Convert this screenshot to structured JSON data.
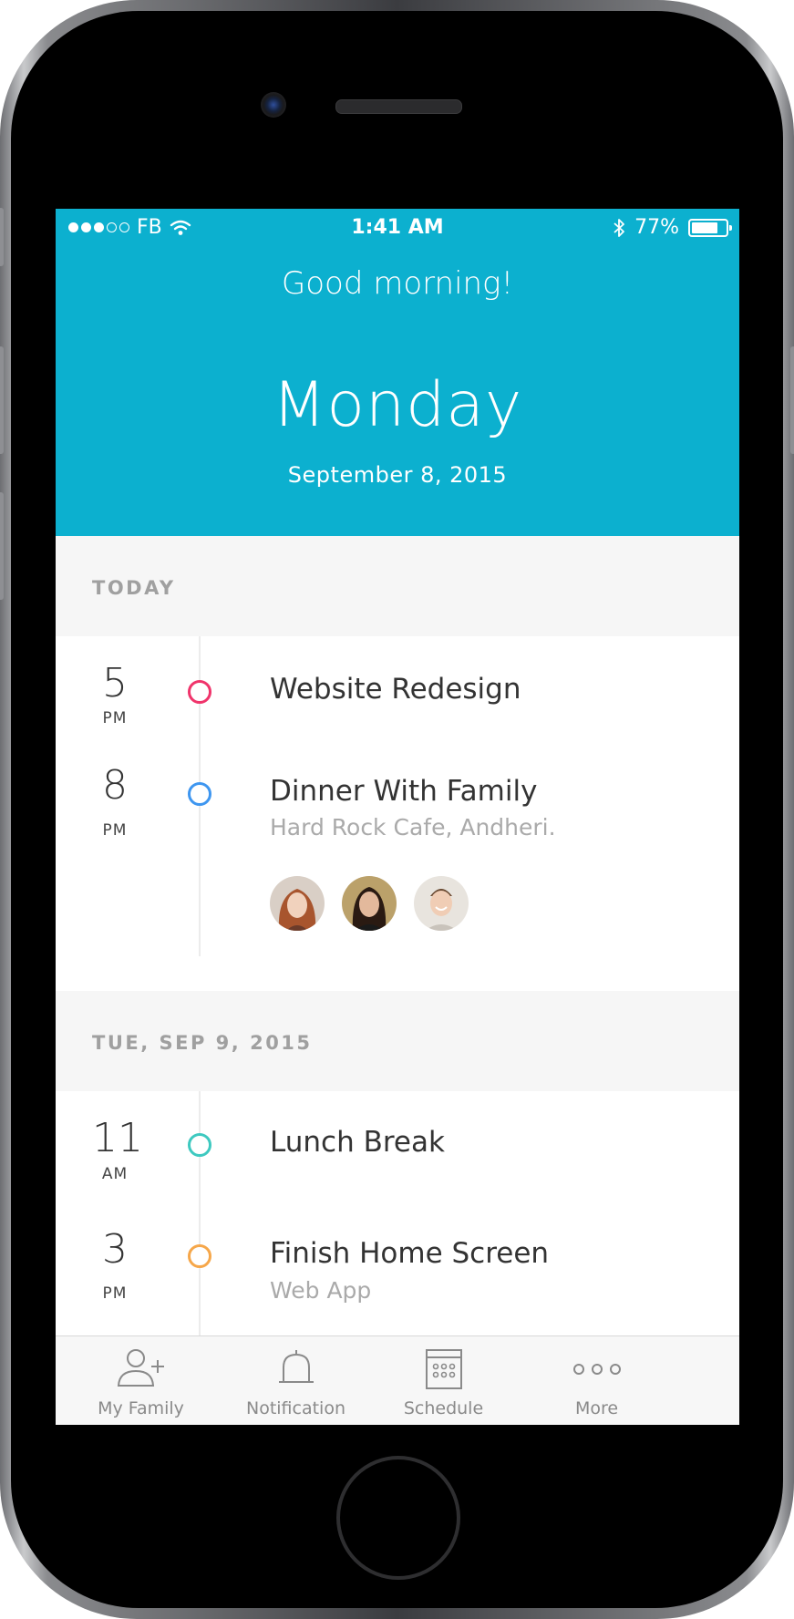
{
  "status_bar": {
    "carrier": "FB",
    "time": "1:41 AM",
    "battery": "77%",
    "battery_level": 0.77
  },
  "header": {
    "greeting": "Good morning!",
    "day": "Monday",
    "date": "September 8, 2015"
  },
  "sections": [
    {
      "label": "TODAY",
      "events": [
        {
          "hour": "5",
          "ampm": "PM",
          "title": "Website Redesign",
          "subtitle": "",
          "color": "#f0346b"
        },
        {
          "hour": "8",
          "ampm": "PM",
          "title": "Dinner With Family",
          "subtitle": "Hard Rock Cafe, Andheri.",
          "color": "#3e96f0"
        }
      ]
    },
    {
      "label": "TUE, SEP 9, 2015",
      "events": [
        {
          "hour": "11",
          "ampm": "AM",
          "title": "Lunch Break",
          "subtitle": "",
          "color": "#3ec9c0"
        },
        {
          "hour": "3",
          "ampm": "PM",
          "title": "Finish Home Screen",
          "subtitle": "Web App",
          "color": "#f6a74a"
        }
      ]
    }
  ],
  "tabbar": {
    "tabs": [
      {
        "label": "My Family",
        "icon": "add-person-icon"
      },
      {
        "label": "Notification",
        "icon": "bell-icon"
      },
      {
        "label": "Schedule",
        "icon": "calendar-grid-icon"
      },
      {
        "label": "More",
        "icon": "more-dots-icon"
      }
    ]
  },
  "colors": {
    "header_bg": "#0cb0cf",
    "section_bg": "#f6f6f6"
  }
}
